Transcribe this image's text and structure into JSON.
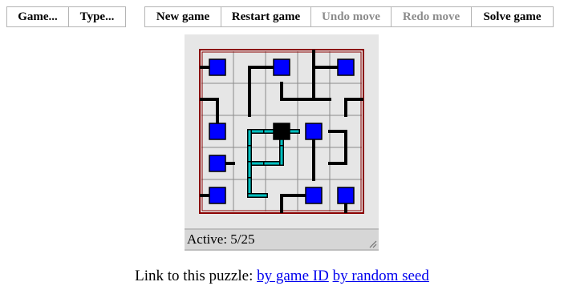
{
  "menu": {
    "game_label": "Game...",
    "type_label": "Type..."
  },
  "toolbar": {
    "new_game": "New game",
    "restart_game": "Restart game",
    "undo_move": "Undo move",
    "redo_move": "Redo move",
    "solve_game": "Solve game"
  },
  "status": {
    "text": "Active: 5/25"
  },
  "links": {
    "prefix": "Link to this puzzle:",
    "by_game_id": "by game ID",
    "by_random_seed": "by random seed"
  },
  "puzzle": {
    "rows": 5,
    "cols": 5,
    "tiles": [
      {
        "r": 0,
        "c": 0,
        "type": "endpoint",
        "conn": "L",
        "active": false
      },
      {
        "r": 0,
        "c": 1,
        "type": "wire",
        "conn": "RD",
        "active": false
      },
      {
        "r": 0,
        "c": 2,
        "type": "endpoint",
        "conn": "L",
        "active": false
      },
      {
        "r": 0,
        "c": 3,
        "type": "wire",
        "conn": "UDR",
        "active": false
      },
      {
        "r": 0,
        "c": 4,
        "type": "endpoint",
        "conn": "L",
        "active": false
      },
      {
        "r": 1,
        "c": 0,
        "type": "wire",
        "conn": "LD",
        "active": false
      },
      {
        "r": 1,
        "c": 1,
        "type": "wire",
        "conn": "UD",
        "active": false
      },
      {
        "r": 1,
        "c": 2,
        "type": "wire",
        "conn": "UR",
        "active": false
      },
      {
        "r": 1,
        "c": 3,
        "type": "wire",
        "conn": "LUR",
        "active": false
      },
      {
        "r": 1,
        "c": 4,
        "type": "wire",
        "conn": "DR",
        "active": false
      },
      {
        "r": 2,
        "c": 0,
        "type": "endpoint",
        "conn": "U",
        "active": false
      },
      {
        "r": 2,
        "c": 1,
        "type": "wire",
        "conn": "RD",
        "active": true
      },
      {
        "r": 2,
        "c": 2,
        "type": "source",
        "conn": "LDR",
        "active": true
      },
      {
        "r": 2,
        "c": 3,
        "type": "endpoint",
        "conn": "D",
        "active": false
      },
      {
        "r": 2,
        "c": 4,
        "type": "wire",
        "conn": "LD",
        "active": false
      },
      {
        "r": 3,
        "c": 0,
        "type": "endpoint",
        "conn": "R",
        "active": false
      },
      {
        "r": 3,
        "c": 1,
        "type": "wire",
        "conn": "URD",
        "active": true
      },
      {
        "r": 3,
        "c": 2,
        "type": "wire",
        "conn": "LU",
        "active": true
      },
      {
        "r": 3,
        "c": 3,
        "type": "wire",
        "conn": "UD",
        "active": false
      },
      {
        "r": 3,
        "c": 4,
        "type": "wire",
        "conn": "UL",
        "active": false
      },
      {
        "r": 4,
        "c": 0,
        "type": "endpoint",
        "conn": "L",
        "active": false
      },
      {
        "r": 4,
        "c": 1,
        "type": "wire",
        "conn": "UR",
        "active": true
      },
      {
        "r": 4,
        "c": 2,
        "type": "wire",
        "conn": "RD",
        "active": false
      },
      {
        "r": 4,
        "c": 3,
        "type": "endpoint",
        "conn": "L",
        "active": false
      },
      {
        "r": 4,
        "c": 4,
        "type": "endpoint",
        "conn": "D",
        "active": false
      }
    ]
  },
  "colors": {
    "border": "#8b0000",
    "grid": "#8a8a8a",
    "cell_bg": "#e6e6e6",
    "wire": "#000000",
    "active_wire": "#00bfbf",
    "endpoint": "#0000ff",
    "source": "#000000"
  }
}
